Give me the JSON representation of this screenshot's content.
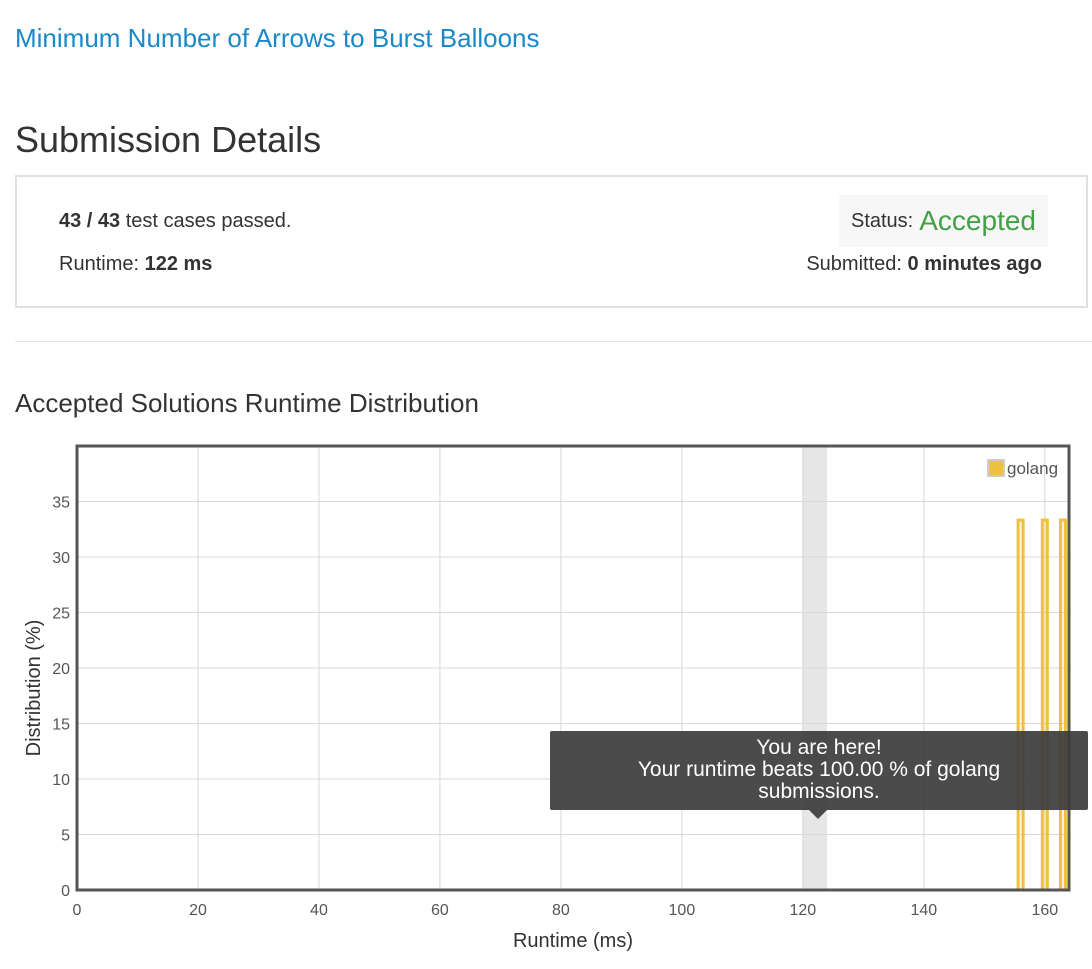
{
  "problem": {
    "title": "Minimum Number of Arrows to Burst Balloons"
  },
  "page": {
    "title": "Submission Details"
  },
  "summary": {
    "cases_count": "43 / 43",
    "cases_text": " test cases passed.",
    "runtime_label": "Runtime: ",
    "runtime_value": "122 ms",
    "status_label": "Status: ",
    "status_value": "Accepted",
    "submitted_label": "Submitted: ",
    "submitted_value": "0 minutes ago"
  },
  "colors": {
    "link": "#1a88c9",
    "accepted": "#43a047",
    "bar": "#f0c040",
    "highlight": "#e6e6e6"
  },
  "chart_section": {
    "title": "Accepted Solutions Runtime Distribution"
  },
  "tooltip": {
    "line1": "You are here!",
    "line2": "Your runtime beats 100.00 % of golang",
    "line3": "submissions."
  },
  "chart_data": {
    "type": "bar",
    "xlabel": "Runtime (ms)",
    "ylabel": "Distribution (%)",
    "xlim": [
      0,
      164
    ],
    "ylim": [
      0,
      40
    ],
    "xticks": [
      0,
      20,
      40,
      60,
      80,
      100,
      120,
      140,
      160
    ],
    "yticks": [
      0,
      5,
      10,
      15,
      20,
      25,
      30,
      35
    ],
    "grid": true,
    "legend_position": "top-right",
    "highlight_x": 122,
    "series": [
      {
        "name": "golang",
        "x": [
          156,
          160,
          163
        ],
        "values": [
          33.33,
          33.33,
          33.33
        ]
      }
    ]
  }
}
